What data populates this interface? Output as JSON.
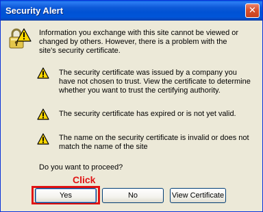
{
  "window": {
    "title": "Security Alert",
    "close_glyph": "✕"
  },
  "icons": {
    "main": "lock-warning-icon",
    "warning": "warning-triangle-icon"
  },
  "body": {
    "intro": "Information you exchange with this site cannot be viewed or changed by others. However, there is a problem with the site's security certificate.",
    "warnings": [
      "The security certificate was issued by a company you have not chosen to trust. View the certificate to determine whether you want to trust the certifying authority.",
      "The security certificate has expired or is not yet valid.",
      "The name on the security certificate is invalid or does not match the name of the site"
    ],
    "question": "Do you want to proceed?"
  },
  "annotation": {
    "label": "Click",
    "color": "#e21313"
  },
  "buttons": {
    "yes": "Yes",
    "no": "No",
    "view_certificate": "View Certificate"
  },
  "colors": {
    "titlebar": "#0055d8",
    "dialog_bg": "#ece9d8",
    "close_button": "#d9522e",
    "warning_yellow": "#ffd800"
  }
}
